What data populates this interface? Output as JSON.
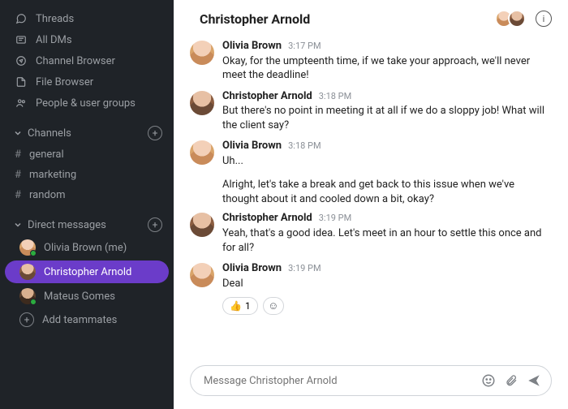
{
  "sidebar": {
    "nav": [
      {
        "label": "Threads",
        "icon": "threads-icon"
      },
      {
        "label": "All DMs",
        "icon": "dms-icon"
      },
      {
        "label": "Channel Browser",
        "icon": "compass-icon"
      },
      {
        "label": "File Browser",
        "icon": "file-icon"
      },
      {
        "label": "People & user groups",
        "icon": "people-icon"
      }
    ],
    "channels_label": "Channels",
    "channels": [
      {
        "label": "general"
      },
      {
        "label": "marketing"
      },
      {
        "label": "random"
      }
    ],
    "dm_label": "Direct messages",
    "dms": [
      {
        "label": "Olivia Brown (me)",
        "presence": true,
        "active": false,
        "avatar": "olivia"
      },
      {
        "label": "Christopher Arnold",
        "presence": false,
        "active": true,
        "avatar": "chris"
      },
      {
        "label": "Mateus Gomes",
        "presence": true,
        "active": false,
        "avatar": "mateus"
      }
    ],
    "add_teammates": "Add teammates"
  },
  "header": {
    "title": "Christopher Arnold"
  },
  "messages": [
    {
      "author": "Olivia Brown",
      "time": "3:17 PM",
      "avatar": "olivia",
      "text": "Okay, for the umpteenth time, if we take your approach, we'll never meet the deadline!"
    },
    {
      "author": "Christopher Arnold",
      "time": "3:18 PM",
      "avatar": "chris",
      "text": "But there's no point in meeting it at all if we do a sloppy job! What will the client say?"
    },
    {
      "author": "Olivia Brown",
      "time": "3:18 PM",
      "avatar": "olivia",
      "text": "Uh...",
      "continuation": "Alright, let's take a break and get back to this issue when we've thought about it and cooled down a bit, okay?"
    },
    {
      "author": "Christopher Arnold",
      "time": "3:19 PM",
      "avatar": "chris",
      "text": "Yeah, that's a good idea. Let's meet in an hour to settle this once and for all?"
    },
    {
      "author": "Olivia Brown",
      "time": "3:19 PM",
      "avatar": "olivia",
      "text": "Deal",
      "reactions": [
        {
          "emoji": "👍",
          "count": "1"
        }
      ]
    }
  ],
  "composer": {
    "placeholder": "Message Christopher Arnold"
  }
}
